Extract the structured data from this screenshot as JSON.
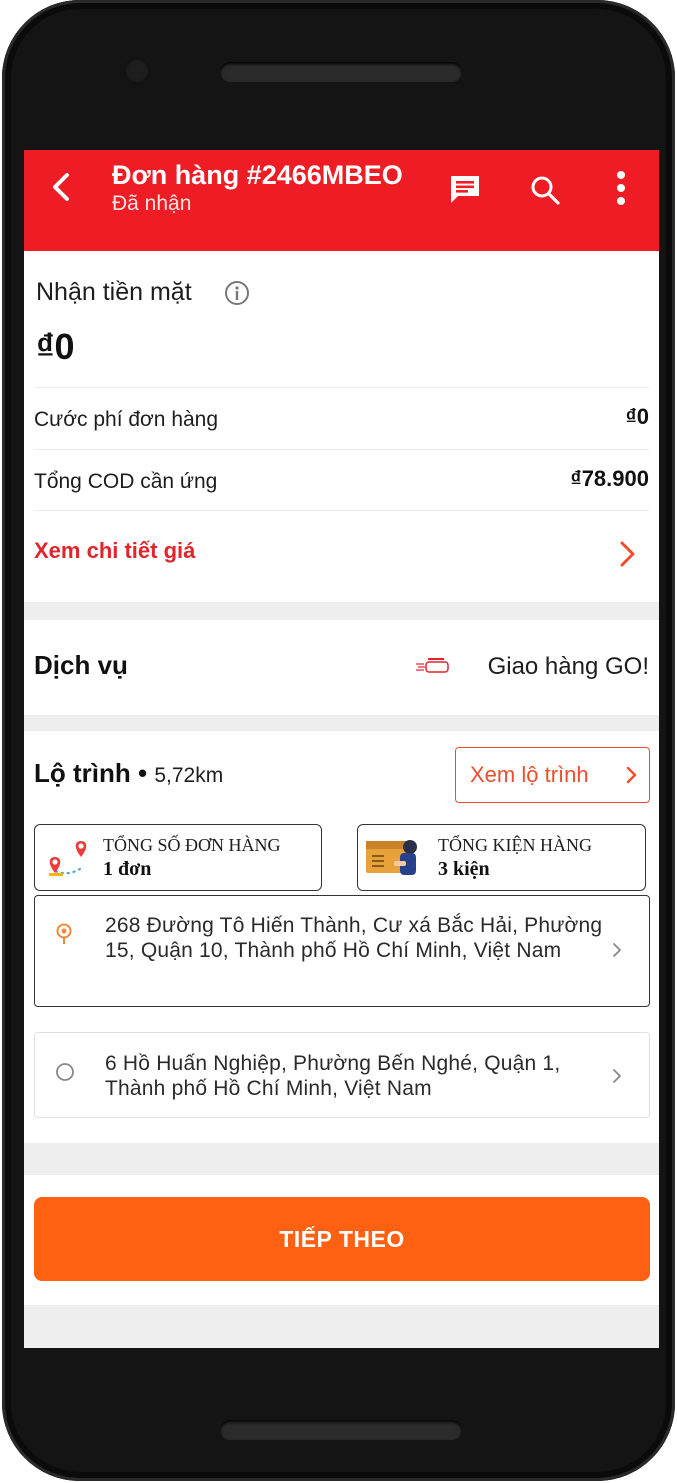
{
  "header": {
    "title": "Đơn hàng #2466MBEO",
    "subtitle": "Đã nhận"
  },
  "payment": {
    "cash_label": "Nhận tiền mặt",
    "cash_amount": "₫0",
    "rows": [
      {
        "label": "Cước phí đơn hàng",
        "value": "₫0"
      },
      {
        "label": "Tổng COD cần ứng",
        "value": "₫78.900"
      }
    ],
    "details_link": "Xem chi tiết giá"
  },
  "service": {
    "label": "Dịch vụ",
    "value": "Giao hàng GO!"
  },
  "route": {
    "label": "Lộ trình",
    "separator": "•",
    "distance": "5,72km",
    "view_button": "Xem lộ trình",
    "stats": [
      {
        "title": "TỔNG SỐ ĐƠN HÀNG",
        "value": "1 đơn"
      },
      {
        "title": "TỔNG KIỆN HÀNG",
        "value": "3 kiện"
      }
    ],
    "stops": [
      {
        "address": "268 Đường Tô Hiến Thành, Cư xá Bắc Hải, Phường 15, Quận 10, Thành phố Hồ Chí Minh, Việt Nam"
      },
      {
        "address": "6 Hồ Huấn Nghiệp, Phường Bến Nghé, Quận 1, Thành phố Hồ Chí Minh, Việt Nam"
      }
    ]
  },
  "actions": {
    "next_label": "TIẾP THEO"
  },
  "colors": {
    "header_red": "#ee1c25",
    "link_red": "#e0262b",
    "accent_orange": "#ee4d2d",
    "button_orange": "#ff6012"
  }
}
